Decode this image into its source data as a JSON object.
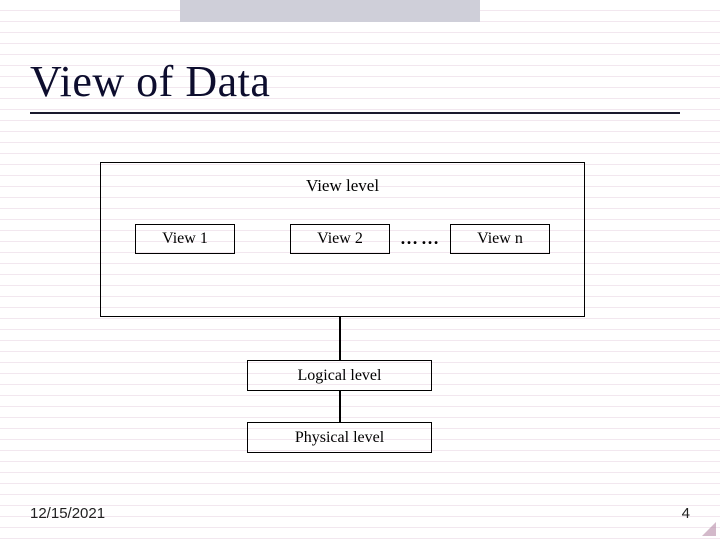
{
  "slide": {
    "title": "View of Data",
    "view_level_label": "View level",
    "views": {
      "v1": "View 1",
      "v2": "View 2",
      "vn": "View n",
      "dots": "……"
    },
    "logical_label": "Logical level",
    "physical_label": "Physical level"
  },
  "footer": {
    "date": "12/15/2021",
    "page": "4"
  }
}
